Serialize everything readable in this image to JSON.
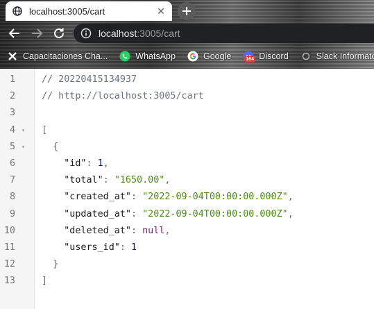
{
  "browser": {
    "tab": {
      "title": "localhost:3005/cart",
      "close_glyph": "✕"
    },
    "new_tab_glyph": "+",
    "address": {
      "host": "localhost",
      "path": ":3005/cart"
    },
    "bookmarks": [
      {
        "label": "Capacitaciones Cha...",
        "icon": "tools-icon"
      },
      {
        "label": "WhatsApp",
        "icon": "whatsapp-icon"
      },
      {
        "label": "Google",
        "icon": "google-icon"
      },
      {
        "label": "Discord",
        "icon": "discord-icon",
        "badge": "164"
      },
      {
        "label": "Slack Informatorio",
        "icon": "slack-icon"
      }
    ]
  },
  "viewer": {
    "lines": [
      {
        "n": "1",
        "text": "// 20220415134937"
      },
      {
        "n": "2",
        "text": "// http://localhost:3005/cart"
      },
      {
        "n": "3",
        "text": ""
      },
      {
        "n": "4",
        "text": "[",
        "fold": "▾"
      },
      {
        "n": "5",
        "text": "  {",
        "fold": "▾"
      },
      {
        "n": "6",
        "key": "\"id\"",
        "value": "1",
        "vtype": "num",
        "comma": ","
      },
      {
        "n": "7",
        "key": "\"total\"",
        "value": "\"1650.00\"",
        "vtype": "str",
        "comma": ","
      },
      {
        "n": "8",
        "key": "\"created_at\"",
        "value": "\"2022-09-04T00:00:00.000Z\"",
        "vtype": "str",
        "comma": ","
      },
      {
        "n": "9",
        "key": "\"updated_at\"",
        "value": "\"2022-09-04T00:00:00.000Z\"",
        "vtype": "str",
        "comma": ","
      },
      {
        "n": "10",
        "key": "\"deleted_at\"",
        "value": "null",
        "vtype": "null",
        "comma": ","
      },
      {
        "n": "11",
        "key": "\"users_id\"",
        "value": "1",
        "vtype": "num",
        "comma": ""
      },
      {
        "n": "12",
        "text": "  }"
      },
      {
        "n": "13",
        "text": "]"
      }
    ]
  }
}
